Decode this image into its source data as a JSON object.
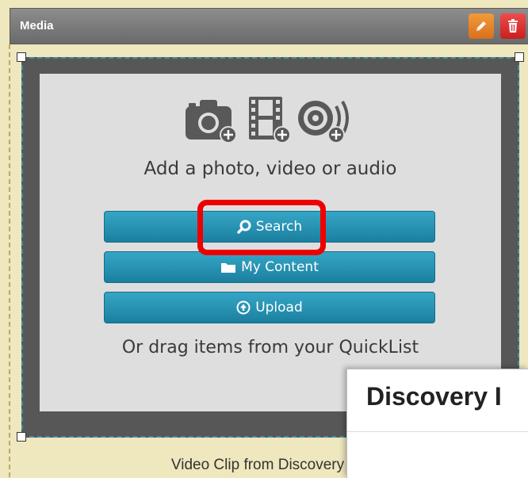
{
  "widget": {
    "title": "Media",
    "edit_icon": "pencil-icon",
    "delete_icon": "trash-icon"
  },
  "dropzone": {
    "icons": [
      "camera-add-icon",
      "film-add-icon",
      "audio-add-icon"
    ],
    "prompt": "Add a photo, video or audio",
    "buttons": {
      "search": {
        "label": "Search",
        "icon": "search-icon"
      },
      "my_content": {
        "label": "My Content",
        "icon": "folder-icon"
      },
      "upload": {
        "label": "Upload",
        "icon": "upload-icon"
      }
    },
    "drag_hint": "Or drag items from your QuickList"
  },
  "caption": "Video Clip from Discovery E",
  "popup": {
    "title": "Discovery I"
  },
  "colors": {
    "header": "#7a7a7a",
    "button": "#2a93b4",
    "highlight": "#ee0000",
    "edit": "#e8862b",
    "delete": "#d93131",
    "background": "#efe7bd"
  }
}
